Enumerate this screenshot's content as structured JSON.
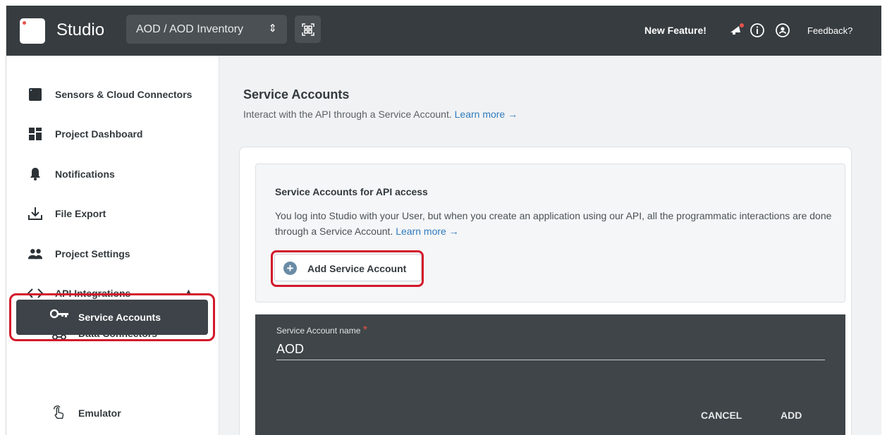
{
  "header": {
    "app_title": "Studio",
    "project_selector": "AOD / AOD Inventory",
    "new_feature": "New Feature!",
    "feedback": "Feedback?"
  },
  "sidebar": {
    "items": [
      {
        "label": "Sensors & Cloud Connectors",
        "icon": "sensor-icon"
      },
      {
        "label": "Project Dashboard",
        "icon": "dashboard-icon"
      },
      {
        "label": "Notifications",
        "icon": "bell-icon"
      },
      {
        "label": "File Export",
        "icon": "download-icon"
      },
      {
        "label": "Project Settings",
        "icon": "people-icon"
      },
      {
        "label": "API Integrations",
        "icon": "code-icon"
      },
      {
        "label": "Data Connectors",
        "icon": "webhook-icon"
      },
      {
        "label": "Service Accounts",
        "icon": "key-icon"
      },
      {
        "label": "Emulator",
        "icon": "touch-icon"
      }
    ]
  },
  "main": {
    "title": "Service Accounts",
    "subtitle": "Interact with the API through a Service Account.",
    "subtitle_link": "Learn more →",
    "info_title": "Service Accounts for API access",
    "info_text": "You log into Studio with your User, but when you create an application using our API, all the programmatic interactions are done through a Service Account.",
    "info_link": "Learn more →",
    "add_button": "Add Service Account",
    "form": {
      "name_label": "Service Account name",
      "required_mark": "*",
      "name_value": "AOD",
      "cancel": "CANCEL",
      "add": "ADD"
    }
  },
  "colors": {
    "topbar": "#363c40",
    "highlight": "#d3192b",
    "link": "#2f7bbd",
    "active_nav": "#3d4348"
  }
}
